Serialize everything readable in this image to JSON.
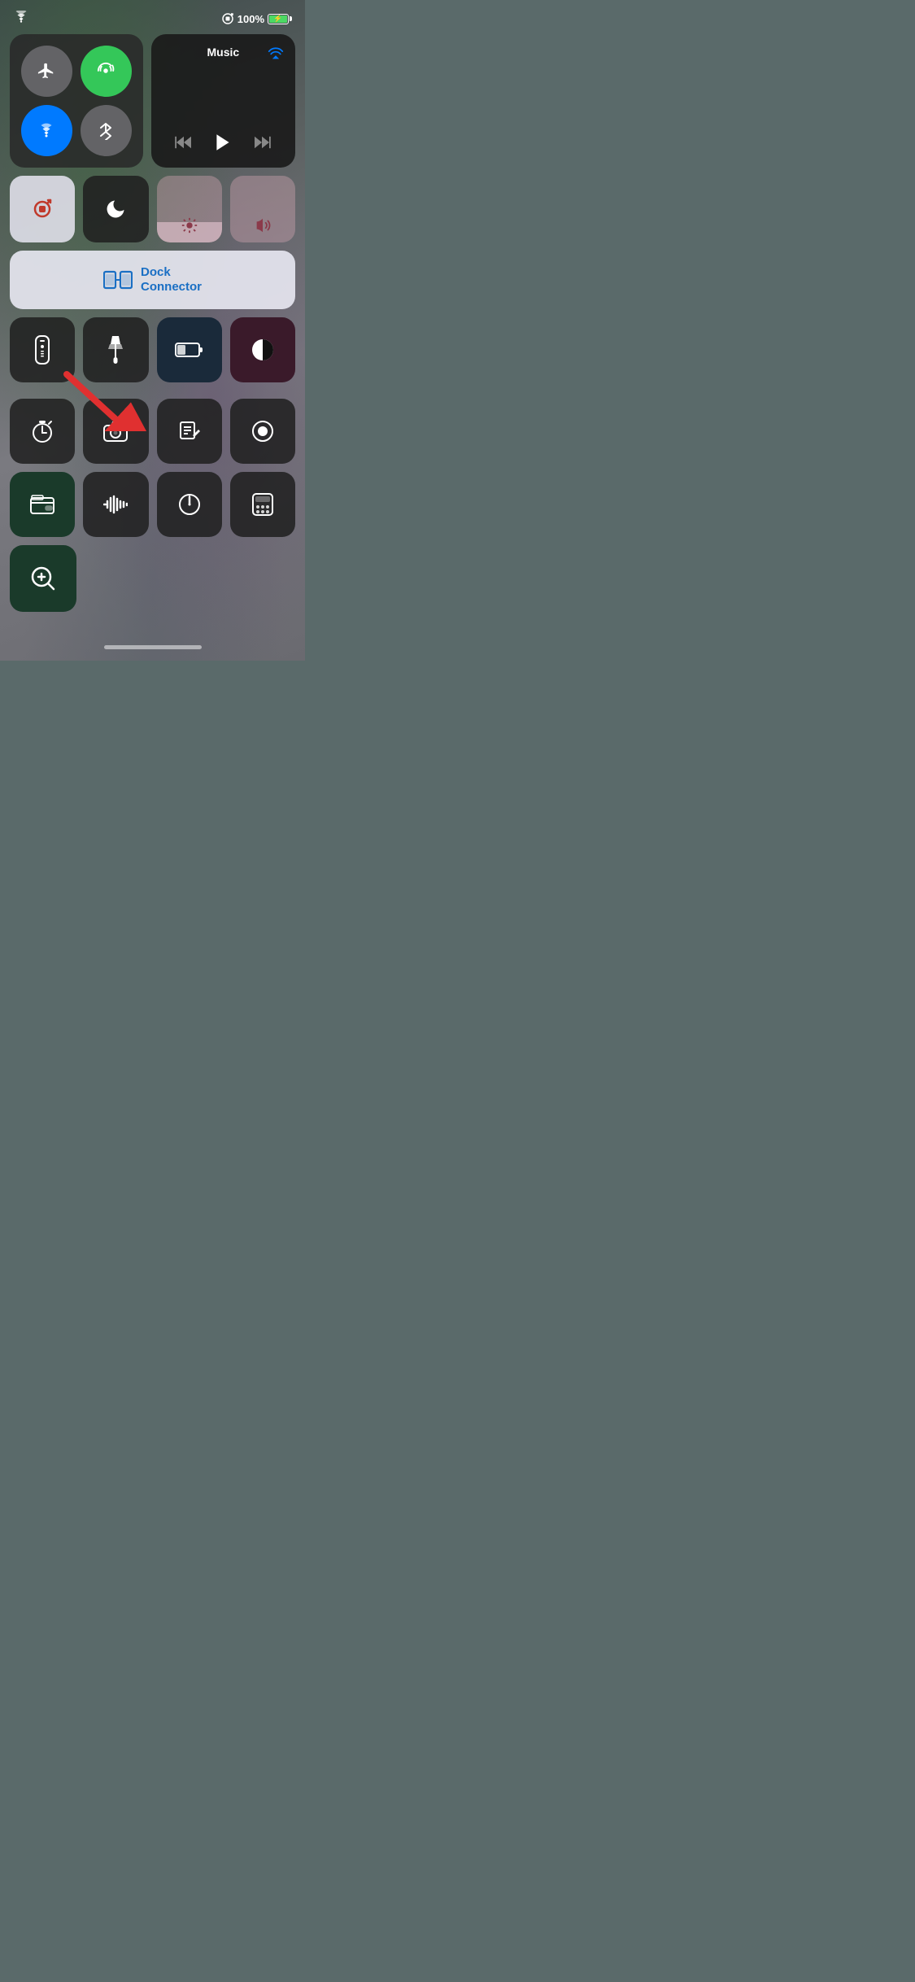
{
  "statusBar": {
    "battery_pct": "100%",
    "battery_charging": true
  },
  "connectivity": {
    "airplane_mode": false,
    "cellular_enabled": true,
    "wifi_enabled": true,
    "bluetooth_enabled": false
  },
  "music": {
    "title": "Music",
    "now_playing": ""
  },
  "controls": {
    "rotation_lock_label": "Rotation Lock",
    "do_not_disturb_label": "Do Not Disturb",
    "dock_connector_label": "Dock\nConnector",
    "dock_connector_line1": "Dock",
    "dock_connector_line2": "Connector"
  },
  "rows": {
    "row3_buttons": [
      "remote-icon",
      "flashlight-icon",
      "battery-low-icon",
      "invert-colors-icon"
    ],
    "row4_buttons": [
      "timer-icon",
      "camera-icon",
      "notes-icon",
      "record-icon"
    ],
    "row5_buttons": [
      "wallet-icon",
      "soundrecog-icon",
      "clock-icon",
      "calculator-icon"
    ]
  },
  "magnifier": {
    "label": "Magnifier"
  }
}
